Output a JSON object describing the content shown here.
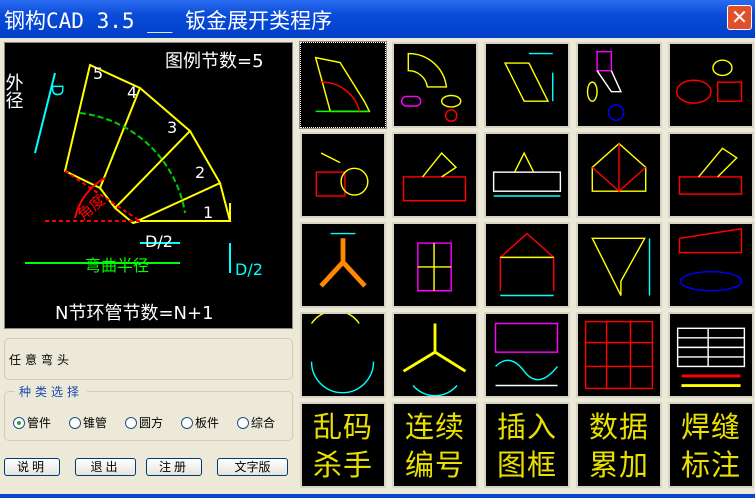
{
  "window": {
    "title": "钢构CAD 3.5 __ 钣金展开类程序",
    "close_icon": "close-icon"
  },
  "preview": {
    "node_label": "图例节数=5",
    "outer_dia_label": "外径",
    "outer_dia_symbol": "D",
    "angle_label": "角度",
    "half_d": "D/2",
    "bend_radius_label": "弯曲半径",
    "half_d_right": "D/2",
    "segments": [
      "1",
      "2",
      "3",
      "4",
      "5"
    ],
    "formula": "N节环管节数=N+1"
  },
  "current_item": "任意弯头",
  "category": {
    "legend": "种类选择",
    "options": [
      {
        "label": "管件",
        "selected": true
      },
      {
        "label": "锥管",
        "selected": false
      },
      {
        "label": "圆方",
        "selected": false
      },
      {
        "label": "板件",
        "selected": false
      },
      {
        "label": "综合",
        "selected": false
      }
    ]
  },
  "buttons": {
    "help": "说明",
    "exit": "退出",
    "register": "注册",
    "text_version": "文字版"
  },
  "text_tiles": [
    {
      "line1": "乱码",
      "line2": "杀手"
    },
    {
      "line1": "连续",
      "line2": "编号"
    },
    {
      "line1": "插入",
      "line2": "图框"
    },
    {
      "line1": "数据",
      "line2": "累加"
    },
    {
      "line1": "焊缝",
      "line2": "标注"
    }
  ]
}
